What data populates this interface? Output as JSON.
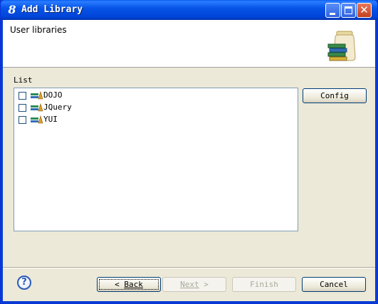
{
  "window": {
    "title": "Add Library",
    "app_glyph": "8"
  },
  "titlebar_buttons": {
    "minimize": "minimize-icon",
    "maximize": "maximize-icon",
    "close": "close-icon"
  },
  "banner": {
    "title": "User libraries",
    "image": "library-jar-icon"
  },
  "list": {
    "label": "List",
    "items": [
      {
        "label": "DOJO",
        "checked": false
      },
      {
        "label": "JQuery",
        "checked": false
      },
      {
        "label": "YUI",
        "checked": false
      }
    ]
  },
  "buttons": {
    "config": "Config",
    "back_arrow": "<",
    "back_label": "Back",
    "next_label": "Next",
    "next_arrow": ">",
    "finish": "Finish",
    "cancel": "Cancel",
    "help": "?"
  }
}
